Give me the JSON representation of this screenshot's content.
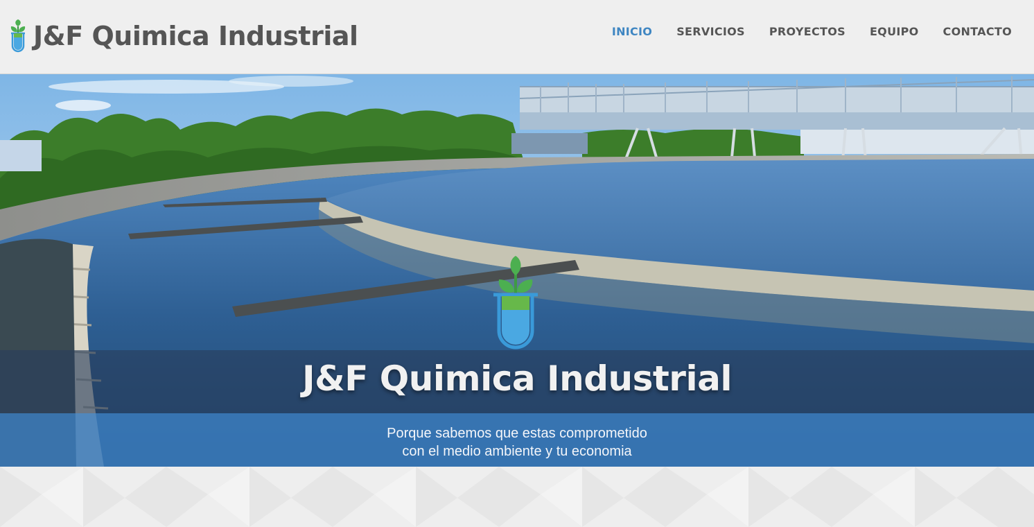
{
  "site": {
    "brand_name": "J&F Quimica Industrial"
  },
  "nav": {
    "items": [
      {
        "label": "INICIO",
        "active": true
      },
      {
        "label": "SERVICIOS",
        "active": false
      },
      {
        "label": "PROYECTOS",
        "active": false
      },
      {
        "label": "EQUIPO",
        "active": false
      },
      {
        "label": "CONTACTO",
        "active": false
      }
    ]
  },
  "hero": {
    "title": "J&F Quimica Industrial",
    "tagline_line1": "Porque sabemos que estas comprometido",
    "tagline_line2": "con el medio ambiente y tu economia",
    "image": "water-treatment-clarifier-photo"
  },
  "colors": {
    "accent": "#3f86c2",
    "nav_text": "#555555",
    "logo_leaf": "#4caf50",
    "logo_tube": "#3a9ad9",
    "header_bg": "#efefef"
  },
  "icons": {
    "logo": "plant-test-tube-icon"
  }
}
